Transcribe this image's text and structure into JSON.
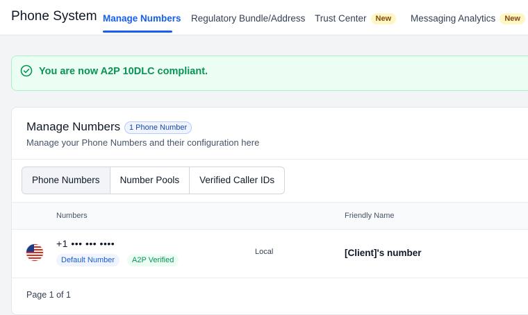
{
  "header": {
    "app_title": "Phone System",
    "tabs": [
      {
        "label": "Manage Numbers",
        "active": true
      },
      {
        "label": "Regulatory Bundle/Address"
      },
      {
        "label": "Trust Center",
        "badge": "New"
      },
      {
        "label": "Messaging Analytics",
        "badge": "New"
      }
    ]
  },
  "banner": {
    "message": "You are now A2P 10DLC compliant.",
    "icon": "check-circle-icon"
  },
  "card": {
    "title": "Manage Numbers",
    "count_badge": "1 Phone Number",
    "subtitle": "Manage your Phone Numbers and their configuration here",
    "segments": [
      "Phone Numbers",
      "Number Pools",
      "Verified Caller IDs"
    ],
    "active_segment": "Phone Numbers",
    "table": {
      "columns": [
        "Numbers",
        "Friendly Name"
      ],
      "rows": [
        {
          "country_flag": "us-flag-icon",
          "number": "+1 ••• ••• ••••",
          "tags": [
            "Default Number",
            "A2P Verified"
          ],
          "type": "Local",
          "friendly_name": "[Client]'s number"
        }
      ]
    },
    "pagination": "Page 1 of 1"
  },
  "colors": {
    "accent": "#155eef",
    "success": "#079455",
    "new_badge_bg": "#fef7c3"
  }
}
